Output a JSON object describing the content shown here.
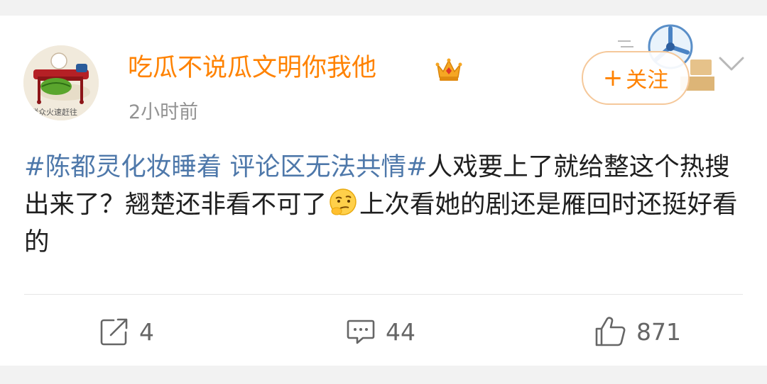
{
  "post": {
    "author": {
      "name": "吃瓜不说瓜文明你我他",
      "avatar_caption": "群众火速赶往"
    },
    "time": "2小时前",
    "follow_label": "关注",
    "follow_plus": "+",
    "text": {
      "hashtag": "#陈都灵化妆睡着 评论区无法共情#",
      "part1": "人戏要上了就给整这个热搜出来了？翘楚还非看不可了",
      "part2": "上次看她的剧还是雁回时还挺好看的"
    },
    "actions": {
      "repost_count": "4",
      "comment_count": "44",
      "like_count": "871"
    }
  },
  "colors": {
    "accent": "#ff8200",
    "hashtag": "#4e78aa",
    "text": "#1f1f1f",
    "muted": "#939393"
  },
  "icons": {
    "crown": "crown-icon",
    "chevron": "chevron-down-icon",
    "repost": "repost-icon",
    "comment": "comment-icon",
    "like": "like-icon",
    "thinking_emoji": "thinking-face-icon"
  }
}
